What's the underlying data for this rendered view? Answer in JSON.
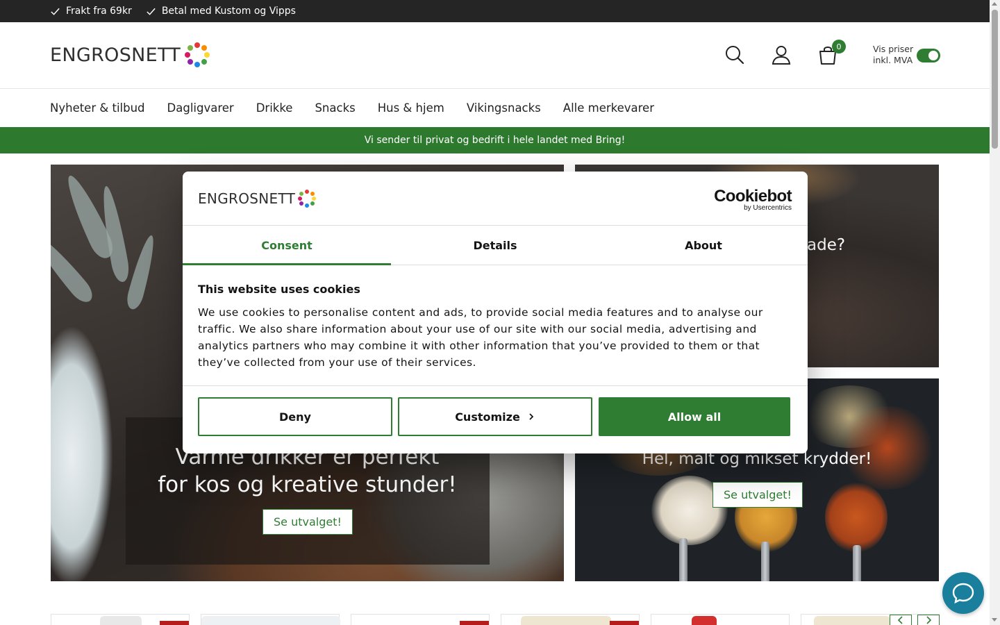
{
  "topbar": {
    "usps": [
      "Frakt fra 69kr",
      "Betal med Kustom og Vipps"
    ]
  },
  "header": {
    "logo_text": "ENGROSNETT",
    "cart_count": "0",
    "vat_label_line1": "Vis priser",
    "vat_label_line2": "inkl. MVA",
    "vat_toggle_on": true
  },
  "nav": {
    "items": [
      "Nyheter & tilbud",
      "Dagligvarer",
      "Drikke",
      "Snacks",
      "Hus & hjem",
      "Vikingsnacks",
      "Alle merkevarer"
    ]
  },
  "banner": {
    "text": "Vi sender til privat og bedrift i hele landet med Bring!"
  },
  "hero": {
    "left_title_line1": "Varme drikker er perfekt",
    "left_title_line2": "for kos og kreative stunder!",
    "left_button": "Se utvalget!",
    "right_top_partial": "ade?",
    "right_bottom_title": "Hel, malt og mikset krydder!",
    "right_bottom_button": "Se utvalget!"
  },
  "cookie_dialog": {
    "logo_text": "ENGROSNETT",
    "brand": "Cookiebot",
    "brand_sub": "by Usercentrics",
    "tabs": [
      "Consent",
      "Details",
      "About"
    ],
    "active_tab": "Consent",
    "heading": "This website uses cookies",
    "body": "We use cookies to personalise content and ads, to provide social media features and to analyse our traffic. We also share information about your use of our site with our social media, advertising and analytics partners who may combine it with other information that you’ve provided to them or that they’ve collected from your use of their services.",
    "buttons": {
      "deny": "Deny",
      "customize": "Customize",
      "allow_all": "Allow all"
    }
  },
  "colors": {
    "brand_green": "#2e7d32",
    "topbar": "#252525",
    "sale_tag": "#b71c1c",
    "chat": "#1a7f9c"
  },
  "icons": [
    "check-icon",
    "search-icon",
    "user-icon",
    "cart-icon",
    "chevron-right-icon",
    "chevron-left-icon",
    "chat-icon"
  ]
}
